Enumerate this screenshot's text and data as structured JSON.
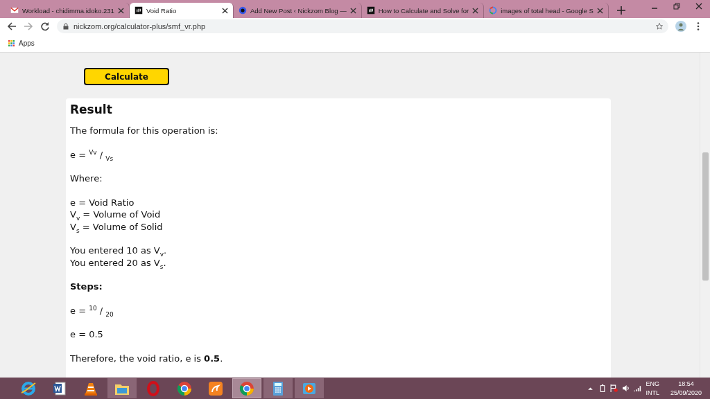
{
  "browser": {
    "tabs": [
      {
        "title": "Workload - chidimma.idoko.231",
        "kind": "mail",
        "selected": false
      },
      {
        "title": "Void Ratio",
        "kind": "square",
        "selected": true
      },
      {
        "title": "Add New Post ‹ Nickzom Blog —",
        "kind": "circle",
        "selected": false
      },
      {
        "title": "How to Calculate and Solve for",
        "kind": "square",
        "selected": false
      },
      {
        "title": "images of total head - Google S",
        "kind": "g",
        "selected": false
      }
    ],
    "address": "nickzom.org/calculator-plus/smf_vr.php",
    "bookmarks": [
      "Apps"
    ]
  },
  "page": {
    "button": "Calculate",
    "result": {
      "title": "Result",
      "blocks": [
        {
          "kind": "text",
          "lines": [
            "The formula for this operation is:"
          ]
        },
        {
          "kind": "text",
          "lines": [
            "e = $^{Vv}$ / $_{Vs}$"
          ]
        },
        {
          "kind": "text",
          "lines": [
            "Where:"
          ]
        },
        {
          "kind": "text",
          "lines": [
            "e = Void Ratio",
            "V$_{v}$ = Volume of Void",
            "V$_{s}$ = Volume of Solid"
          ]
        },
        {
          "kind": "text",
          "lines": [
            "You entered 10 as V$_{v}$.",
            "You entered 20 as V$_{s}$."
          ]
        },
        {
          "kind": "strong",
          "lines": [
            "Steps:"
          ]
        },
        {
          "kind": "text",
          "lines": [
            "e = $^{10}$ / $_{20}$"
          ]
        },
        {
          "kind": "text",
          "lines": [
            "e = 0.5"
          ]
        },
        {
          "kind": "text",
          "lines": [
            "Therefore, the void ratio, e is **0.5**."
          ]
        }
      ]
    }
  },
  "taskbar": {
    "apps": [
      {
        "kind": "ie",
        "open": false,
        "selected": false
      },
      {
        "kind": "word",
        "open": false,
        "selected": false
      },
      {
        "kind": "cone",
        "open": false,
        "selected": false
      },
      {
        "kind": "folder",
        "open": true,
        "selected": false
      },
      {
        "kind": "ring",
        "open": false,
        "selected": false
      },
      {
        "kind": "chrome",
        "open": false,
        "selected": false
      },
      {
        "kind": "squirrel",
        "open": false,
        "selected": false
      },
      {
        "kind": "chrome",
        "open": true,
        "selected": true
      },
      {
        "kind": "calculator",
        "open": true,
        "selected": false
      },
      {
        "kind": "player",
        "open": true,
        "selected": false
      }
    ],
    "language": [
      "ENG",
      "INTL"
    ],
    "time": "18:54",
    "date": "25/09/2020"
  }
}
